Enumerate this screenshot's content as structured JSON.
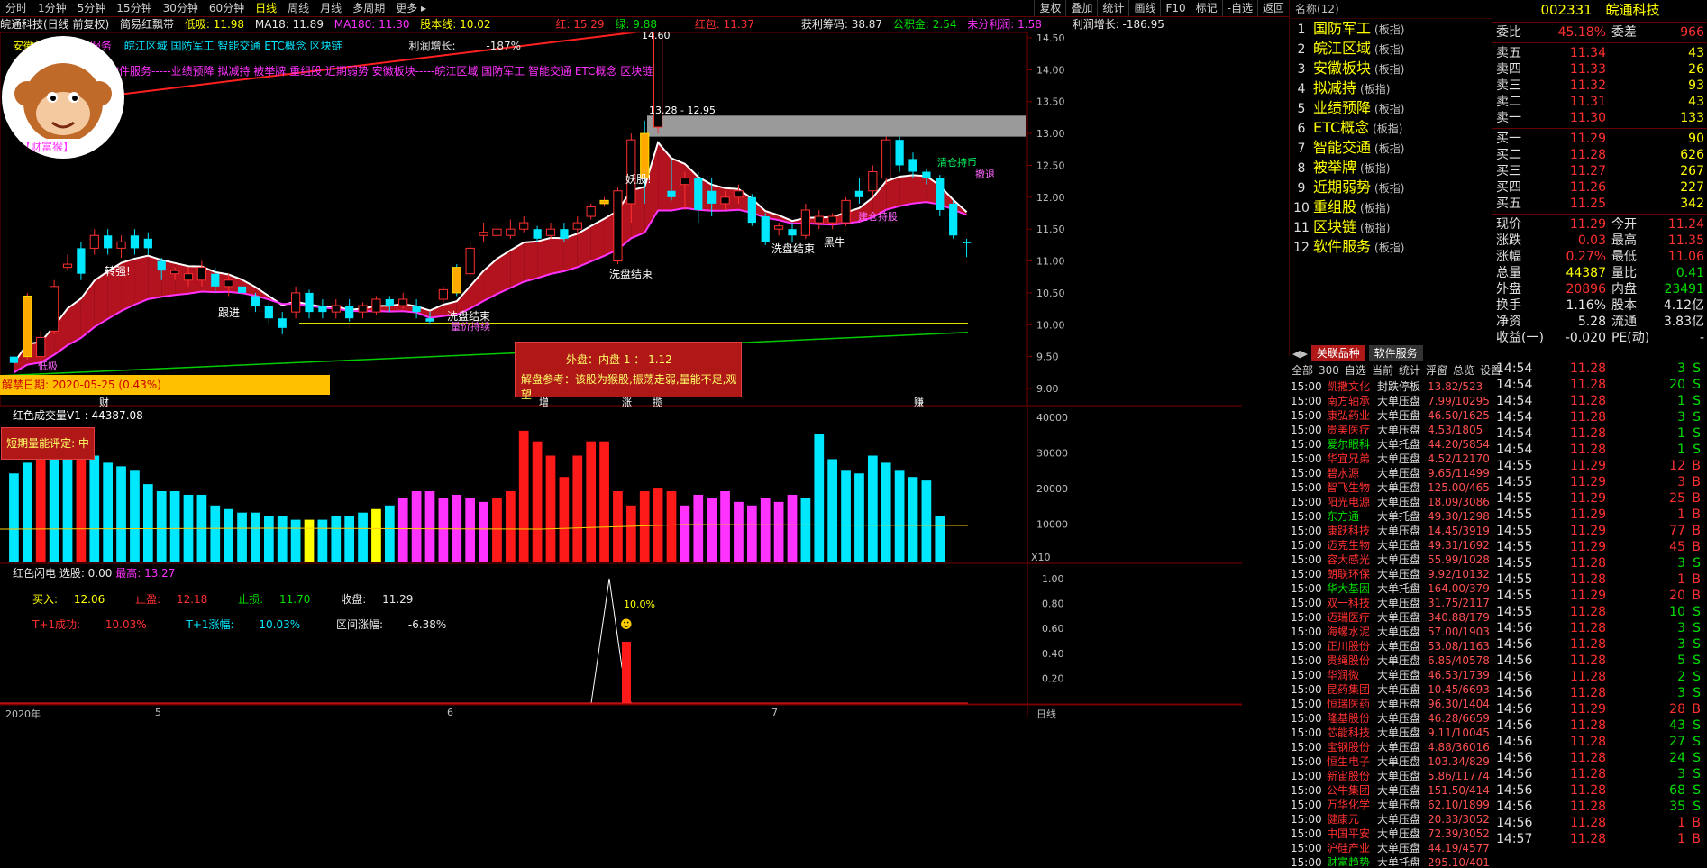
{
  "menu": {
    "items": [
      "分时",
      "1分钟",
      "5分钟",
      "15分钟",
      "30分钟",
      "60分钟",
      "日线",
      "周线",
      "月线",
      "多周期",
      "更多 ▸"
    ],
    "active_index": 6,
    "right_items": [
      "复权",
      "叠加",
      "统计",
      "画线",
      "F10",
      "标记",
      "-自选",
      "返回"
    ]
  },
  "info": {
    "stock": "皖通科技(日线 前复权)",
    "formula": "简易红飘带",
    "low_label": "低吸: 11.98",
    "ma18": "MA18: 11.89",
    "ma180": "MA180: 11.30",
    "stock_line": "股本线: 10.02",
    "red": "红: 15.29",
    "green": "绿: 9.88",
    "red_bag": "红包: 11.37",
    "profit_chip": "获利筹码: 38.87",
    "reserve": "公积金: 2.54",
    "undistributed": "未分利润: 1.58",
    "profit_growth": "利润增长: -186.95"
  },
  "overlay": {
    "tags_line1": [
      "安徽板块",
      "软件服务",
      "皖江区域",
      "国防军工",
      "智能交通",
      "ETC概念",
      "区块链"
    ],
    "profit_growth_label": "利润增长:",
    "profit_growth_value": "-187%",
    "logo_caption": "【财富猴】",
    "tags_line2": "软件服务-----业绩预降 拟减持 被举牌 重组股 近期弱势 安徽板块-----皖江区域 国防军工 智能交通 ETC概念 区块链",
    "unlock_date": "解禁日期: 2020-05-25 (0.43%)",
    "peak_label": "14.60",
    "range_label": "13.28 - 12.95",
    "annotations": [
      "转强!",
      "跟进",
      "洗盘结束",
      "洗盘结束",
      "量价持续",
      "妖股!",
      "洗盘结束",
      "洗盘结束",
      "黑牛",
      "建仓持股",
      "清仓持币",
      "撤退",
      "低吸"
    ],
    "bottom_marks": [
      "财",
      "增",
      "涨",
      "揽",
      "赚"
    ],
    "infobox_line1": "外盘：内盘   1  ：  1.12",
    "infobox_line2": "解盘参考：该股为猴股,振荡走弱,量能不足,观望"
  },
  "vol_panel": {
    "title": "红色成交量V1 : 44387.08",
    "box": "短期量能评定: 中",
    "y_ticks": [
      "40000",
      "30000",
      "20000",
      "10000"
    ],
    "scale": "X10"
  },
  "flash_panel": {
    "title": "红色闪电  选股: 0.00",
    "high": "最高: 13.27",
    "buy_label": "买入:",
    "buy": "12.06",
    "tp_label": "止盈:",
    "tp": "12.18",
    "sl_label": "止损:",
    "sl": "11.70",
    "close_label": "收盘:",
    "close": "11.29",
    "t1_success_label": "T+1成功:",
    "t1_success": "10.03%",
    "t1_gain_label": "T+1涨幅:",
    "t1_gain": "10.03%",
    "range_gain_label": "区间涨幅:",
    "range_gain": "-6.38%",
    "pct": "10.0%",
    "y_ticks": [
      "1.00",
      "0.80",
      "0.60",
      "0.40",
      "0.20"
    ]
  },
  "price_axis": [
    "14.50",
    "14.00",
    "13.50",
    "13.00",
    "12.50",
    "12.00",
    "11.50",
    "11.00",
    "10.50",
    "10.00",
    "9.50",
    "9.00"
  ],
  "date_axis": {
    "labels": [
      "2020年",
      "5",
      "6",
      "7"
    ],
    "period": "日线"
  },
  "sectors": {
    "header": "名称(12)",
    "items": [
      {
        "n": "1",
        "name": "国防军工",
        "type": "(板指)"
      },
      {
        "n": "2",
        "name": "皖江区域",
        "type": "(板指)"
      },
      {
        "n": "3",
        "name": "安徽板块",
        "type": "(板指)"
      },
      {
        "n": "4",
        "name": "拟减持",
        "type": "(板指)"
      },
      {
        "n": "5",
        "name": "业绩预降",
        "type": "(板指)"
      },
      {
        "n": "6",
        "name": "ETC概念",
        "type": "(板指)"
      },
      {
        "n": "7",
        "name": "智能交通",
        "type": "(板指)"
      },
      {
        "n": "8",
        "name": "被举牌",
        "type": "(板指)"
      },
      {
        "n": "9",
        "name": "近期弱势",
        "type": "(板指)"
      },
      {
        "n": "10",
        "name": "重组股",
        "type": "(板指)"
      },
      {
        "n": "11",
        "name": "区块链",
        "type": "(板指)"
      },
      {
        "n": "12",
        "name": "软件服务",
        "type": "(板指)"
      }
    ]
  },
  "quote": {
    "code": "002331",
    "name": "皖通科技",
    "ratio_label": "委比",
    "ratio": "45.18%",
    "diff_label": "委差",
    "diff": "966",
    "asks": [
      {
        "l": "卖五",
        "p": "11.34",
        "v": "43"
      },
      {
        "l": "卖四",
        "p": "11.33",
        "v": "26"
      },
      {
        "l": "卖三",
        "p": "11.32",
        "v": "93"
      },
      {
        "l": "卖二",
        "p": "11.31",
        "v": "43"
      },
      {
        "l": "卖一",
        "p": "11.30",
        "v": "133"
      }
    ],
    "bids": [
      {
        "l": "买一",
        "p": "11.29",
        "v": "90"
      },
      {
        "l": "买二",
        "p": "11.28",
        "v": "626"
      },
      {
        "l": "买三",
        "p": "11.27",
        "v": "267"
      },
      {
        "l": "买四",
        "p": "11.26",
        "v": "227"
      },
      {
        "l": "买五",
        "p": "11.25",
        "v": "342"
      }
    ],
    "stats": [
      {
        "a": "现价",
        "av": "11.29",
        "b": "今开",
        "bv": "11.24"
      },
      {
        "a": "涨跌",
        "av": "0.03",
        "b": "最高",
        "bv": "11.35"
      },
      {
        "a": "涨幅",
        "av": "0.27%",
        "b": "最低",
        "bv": "11.06"
      },
      {
        "a": "总量",
        "av": "44387",
        "b": "量比",
        "bv": "0.41"
      },
      {
        "a": "外盘",
        "av": "20896",
        "b": "内盘",
        "bv": "23491"
      },
      {
        "a": "换手",
        "av": "1.16%",
        "b": "股本",
        "bv": "4.12亿"
      },
      {
        "a": "净资",
        "av": "5.28",
        "b": "流通",
        "bv": "3.83亿"
      },
      {
        "a": "收益(一)",
        "av": "-0.020",
        "b": "PE(动)",
        "bv": "-"
      }
    ]
  },
  "rel_tabs": {
    "tab1": "关联品种",
    "tab2": "软件服务",
    "filters": [
      "全部",
      "300",
      "自选",
      "当前",
      "统计",
      "浮窗",
      "总览",
      "设置"
    ]
  },
  "rel_list": [
    {
      "t": "15:00",
      "s": "凯撒文化",
      "k": "封跌停板",
      "v": "13.82/523"
    },
    {
      "t": "15:00",
      "s": "南方轴承",
      "k": "大单压盘",
      "v": "7.99/10295"
    },
    {
      "t": "15:00",
      "s": "康弘药业",
      "k": "大单压盘",
      "v": "46.50/1625"
    },
    {
      "t": "15:00",
      "s": "贵美医疗",
      "k": "大单压盘",
      "v": "4.53/1805"
    },
    {
      "t": "15:00",
      "s": "爱尔眼科",
      "k": "大单托盘",
      "v": "44.20/5854"
    },
    {
      "t": "15:00",
      "s": "华宜兄弟",
      "k": "大单压盘",
      "v": "4.52/12170"
    },
    {
      "t": "15:00",
      "s": "碧水源",
      "k": "大单压盘",
      "v": "9.65/11499"
    },
    {
      "t": "15:00",
      "s": "智飞生物",
      "k": "大单压盘",
      "v": "125.00/465"
    },
    {
      "t": "15:00",
      "s": "阳光电源",
      "k": "大单压盘",
      "v": "18.09/3086"
    },
    {
      "t": "15:00",
      "s": "东方通",
      "k": "大单托盘",
      "v": "49.30/1298"
    },
    {
      "t": "15:00",
      "s": "康跃科技",
      "k": "大单压盘",
      "v": "14.45/3919"
    },
    {
      "t": "15:00",
      "s": "迈克生物",
      "k": "大单压盘",
      "v": "49.31/1692"
    },
    {
      "t": "15:00",
      "s": "容大感光",
      "k": "大单压盘",
      "v": "55.99/1028"
    },
    {
      "t": "15:00",
      "s": "朗联环保",
      "k": "大单压盘",
      "v": "9.92/10132"
    },
    {
      "t": "15:00",
      "s": "华大基因",
      "k": "大单托盘",
      "v": "164.00/379"
    },
    {
      "t": "15:00",
      "s": "双一科技",
      "k": "大单压盘",
      "v": "31.75/2117"
    },
    {
      "t": "15:00",
      "s": "迈瑞医疗",
      "k": "大单压盘",
      "v": "340.88/179"
    },
    {
      "t": "15:00",
      "s": "海螺水泥",
      "k": "大单压盘",
      "v": "57.00/1903"
    },
    {
      "t": "15:00",
      "s": "正川股份",
      "k": "大单压盘",
      "v": "53.08/1163"
    },
    {
      "t": "15:00",
      "s": "贵绳股份",
      "k": "大单压盘",
      "v": "6.85/40578"
    },
    {
      "t": "15:00",
      "s": "华润微",
      "k": "大单压盘",
      "v": "46.53/1739"
    },
    {
      "t": "15:00",
      "s": "昆药集团",
      "k": "大单压盘",
      "v": "10.45/6693"
    },
    {
      "t": "15:00",
      "s": "恒瑞医药",
      "k": "大单压盘",
      "v": "96.30/1404"
    },
    {
      "t": "15:00",
      "s": "隆基股份",
      "k": "大单压盘",
      "v": "46.28/6659"
    },
    {
      "t": "15:00",
      "s": "芯能科技",
      "k": "大单压盘",
      "v": "9.11/10045"
    },
    {
      "t": "15:00",
      "s": "宝钢股份",
      "k": "大单压盘",
      "v": "4.88/36016"
    },
    {
      "t": "15:00",
      "s": "恒生电子",
      "k": "大单压盘",
      "v": "103.34/829"
    },
    {
      "t": "15:00",
      "s": "新宙股份",
      "k": "大单压盘",
      "v": "5.86/11774"
    },
    {
      "t": "15:00",
      "s": "公牛集团",
      "k": "大单压盘",
      "v": "151.50/414"
    },
    {
      "t": "15:00",
      "s": "万华化学",
      "k": "大单压盘",
      "v": "62.10/1899"
    },
    {
      "t": "15:00",
      "s": "健康元",
      "k": "大单压盘",
      "v": "20.33/3052"
    },
    {
      "t": "15:00",
      "s": "中国平安",
      "k": "大单压盘",
      "v": "72.39/3052"
    },
    {
      "t": "15:00",
      "s": "沪硅产业",
      "k": "大单压盘",
      "v": "44.19/4577"
    },
    {
      "t": "15:00",
      "s": "财富趋势",
      "k": "大单托盘",
      "v": "295.10/401"
    }
  ],
  "ticks": [
    {
      "t": "14:54",
      "p": "11.28",
      "v": "3",
      "d": "S"
    },
    {
      "t": "14:54",
      "p": "11.28",
      "v": "20",
      "d": "S"
    },
    {
      "t": "14:54",
      "p": "11.28",
      "v": "1",
      "d": "S"
    },
    {
      "t": "14:54",
      "p": "11.28",
      "v": "3",
      "d": "S"
    },
    {
      "t": "14:54",
      "p": "11.28",
      "v": "1",
      "d": "S"
    },
    {
      "t": "14:54",
      "p": "11.28",
      "v": "1",
      "d": "S"
    },
    {
      "t": "14:55",
      "p": "11.29",
      "v": "12",
      "d": "B"
    },
    {
      "t": "14:55",
      "p": "11.29",
      "v": "3",
      "d": "B"
    },
    {
      "t": "14:55",
      "p": "11.29",
      "v": "25",
      "d": "B"
    },
    {
      "t": "14:55",
      "p": "11.29",
      "v": "1",
      "d": "B"
    },
    {
      "t": "14:55",
      "p": "11.29",
      "v": "77",
      "d": "B"
    },
    {
      "t": "14:55",
      "p": "11.29",
      "v": "45",
      "d": "B"
    },
    {
      "t": "14:55",
      "p": "11.28",
      "v": "3",
      "d": "S"
    },
    {
      "t": "14:55",
      "p": "11.28",
      "v": "1",
      "d": "B"
    },
    {
      "t": "14:55",
      "p": "11.29",
      "v": "20",
      "d": "B"
    },
    {
      "t": "14:55",
      "p": "11.28",
      "v": "10",
      "d": "S"
    },
    {
      "t": "14:56",
      "p": "11.28",
      "v": "3",
      "d": "S"
    },
    {
      "t": "14:56",
      "p": "11.28",
      "v": "3",
      "d": "S"
    },
    {
      "t": "14:56",
      "p": "11.28",
      "v": "5",
      "d": "S"
    },
    {
      "t": "14:56",
      "p": "11.28",
      "v": "2",
      "d": "S"
    },
    {
      "t": "14:56",
      "p": "11.28",
      "v": "3",
      "d": "S"
    },
    {
      "t": "14:56",
      "p": "11.29",
      "v": "28",
      "d": "B"
    },
    {
      "t": "14:56",
      "p": "11.28",
      "v": "43",
      "d": "S"
    },
    {
      "t": "14:56",
      "p": "11.28",
      "v": "27",
      "d": "S"
    },
    {
      "t": "14:56",
      "p": "11.28",
      "v": "24",
      "d": "S"
    },
    {
      "t": "14:56",
      "p": "11.28",
      "v": "3",
      "d": "S"
    },
    {
      "t": "14:56",
      "p": "11.28",
      "v": "68",
      "d": "S"
    },
    {
      "t": "14:56",
      "p": "11.28",
      "v": "35",
      "d": "S"
    },
    {
      "t": "14:56",
      "p": "11.28",
      "v": "1",
      "d": "B"
    },
    {
      "t": "14:57",
      "p": "11.28",
      "v": "1",
      "d": "B"
    }
  ],
  "chart_data": {
    "type": "candlestick",
    "period": "daily",
    "price_range": [
      9.0,
      14.6
    ],
    "candles": [
      {
        "o": 9.5,
        "c": 9.4,
        "h": 9.55,
        "l": 9.3
      },
      {
        "o": 9.5,
        "c": 10.45,
        "h": 10.5,
        "l": 9.45
      },
      {
        "o": 9.5,
        "c": 9.8,
        "h": 9.9,
        "l": 9.45
      },
      {
        "o": 9.9,
        "c": 10.6,
        "h": 10.7,
        "l": 9.85
      },
      {
        "o": 10.9,
        "c": 10.95,
        "h": 11.1,
        "l": 10.85
      },
      {
        "o": 11.2,
        "c": 10.8,
        "h": 11.3,
        "l": 10.7
      },
      {
        "o": 11.2,
        "c": 11.4,
        "h": 11.5,
        "l": 11.1
      },
      {
        "o": 11.4,
        "c": 11.2,
        "h": 11.5,
        "l": 11.1
      },
      {
        "o": 11.2,
        "c": 11.3,
        "h": 11.4,
        "l": 11.05
      },
      {
        "o": 11.4,
        "c": 11.2,
        "h": 11.5,
        "l": 11.1
      },
      {
        "o": 11.35,
        "c": 11.2,
        "h": 11.45,
        "l": 11.1
      },
      {
        "o": 11.0,
        "c": 10.85,
        "h": 11.05,
        "l": 10.7
      },
      {
        "o": 10.8,
        "c": 10.85,
        "h": 10.9,
        "l": 10.7
      },
      {
        "o": 10.7,
        "c": 10.8,
        "h": 10.9,
        "l": 10.6
      },
      {
        "o": 10.7,
        "c": 10.9,
        "h": 11.0,
        "l": 10.6
      },
      {
        "o": 10.8,
        "c": 10.6,
        "h": 10.9,
        "l": 10.5
      },
      {
        "o": 10.6,
        "c": 10.7,
        "h": 10.8,
        "l": 10.45
      },
      {
        "o": 10.6,
        "c": 10.5,
        "h": 10.7,
        "l": 10.4
      },
      {
        "o": 10.45,
        "c": 10.3,
        "h": 10.5,
        "l": 10.2
      },
      {
        "o": 10.3,
        "c": 10.1,
        "h": 10.35,
        "l": 10.0
      },
      {
        "o": 10.1,
        "c": 9.95,
        "h": 10.2,
        "l": 9.85
      },
      {
        "o": 10.2,
        "c": 10.5,
        "h": 10.6,
        "l": 10.1
      },
      {
        "o": 10.5,
        "c": 10.2,
        "h": 10.55,
        "l": 10.1
      },
      {
        "o": 10.3,
        "c": 10.2,
        "h": 10.4,
        "l": 10.1
      },
      {
        "o": 10.2,
        "c": 10.3,
        "h": 10.4,
        "l": 10.1
      },
      {
        "o": 10.3,
        "c": 10.1,
        "h": 10.4,
        "l": 10.05
      },
      {
        "o": 10.2,
        "c": 10.3,
        "h": 10.35,
        "l": 10.1
      },
      {
        "o": 10.2,
        "c": 10.4,
        "h": 10.45,
        "l": 10.15
      },
      {
        "o": 10.4,
        "c": 10.3,
        "h": 10.45,
        "l": 10.2
      },
      {
        "o": 10.3,
        "c": 10.4,
        "h": 10.5,
        "l": 10.25
      },
      {
        "o": 10.3,
        "c": 10.2,
        "h": 10.4,
        "l": 10.1
      },
      {
        "o": 10.1,
        "c": 10.05,
        "h": 10.2,
        "l": 10.0
      },
      {
        "o": 10.4,
        "c": 10.55,
        "h": 10.6,
        "l": 10.35
      },
      {
        "o": 10.9,
        "c": 10.5,
        "h": 10.95,
        "l": 10.45
      },
      {
        "o": 10.8,
        "c": 11.2,
        "h": 11.3,
        "l": 10.75
      },
      {
        "o": 11.4,
        "c": 11.45,
        "h": 11.6,
        "l": 11.3
      },
      {
        "o": 11.4,
        "c": 11.5,
        "h": 11.6,
        "l": 11.3
      },
      {
        "o": 11.4,
        "c": 11.5,
        "h": 11.65,
        "l": 11.35
      },
      {
        "o": 11.5,
        "c": 11.6,
        "h": 11.7,
        "l": 11.45
      },
      {
        "o": 11.5,
        "c": 11.35,
        "h": 11.55,
        "l": 11.3
      },
      {
        "o": 11.4,
        "c": 11.5,
        "h": 11.6,
        "l": 11.35
      },
      {
        "o": 11.5,
        "c": 11.35,
        "h": 11.6,
        "l": 11.3
      },
      {
        "o": 11.5,
        "c": 11.6,
        "h": 11.7,
        "l": 11.4
      },
      {
        "o": 11.7,
        "c": 11.85,
        "h": 11.9,
        "l": 11.65
      },
      {
        "o": 11.9,
        "c": 11.95,
        "h": 12.0,
        "l": 11.85
      },
      {
        "o": 11.0,
        "c": 12.1,
        "h": 12.15,
        "l": 10.95
      },
      {
        "o": 11.9,
        "c": 12.9,
        "h": 13.0,
        "l": 11.6
      },
      {
        "o": 13.0,
        "c": 12.3,
        "h": 13.2,
        "l": 11.9
      },
      {
        "o": 13.1,
        "c": 14.6,
        "h": 14.6,
        "l": 13.0
      },
      {
        "o": 12.1,
        "c": 12.0,
        "h": 12.6,
        "l": 11.95
      },
      {
        "o": 12.2,
        "c": 12.3,
        "h": 12.4,
        "l": 11.8
      },
      {
        "o": 12.3,
        "c": 11.8,
        "h": 12.4,
        "l": 11.6
      },
      {
        "o": 12.1,
        "c": 11.9,
        "h": 12.3,
        "l": 11.7
      },
      {
        "o": 11.9,
        "c": 12.0,
        "h": 12.1,
        "l": 11.8
      },
      {
        "o": 12.0,
        "c": 12.1,
        "h": 12.2,
        "l": 11.9
      },
      {
        "o": 12.0,
        "c": 11.6,
        "h": 12.05,
        "l": 11.55
      },
      {
        "o": 11.7,
        "c": 11.3,
        "h": 11.75,
        "l": 11.25
      },
      {
        "o": 11.5,
        "c": 11.55,
        "h": 11.6,
        "l": 11.4
      },
      {
        "o": 11.5,
        "c": 11.4,
        "h": 11.6,
        "l": 11.3
      },
      {
        "o": 11.4,
        "c": 11.8,
        "h": 11.9,
        "l": 11.35
      },
      {
        "o": 11.6,
        "c": 11.7,
        "h": 11.8,
        "l": 11.5
      },
      {
        "o": 11.6,
        "c": 11.7,
        "h": 11.75,
        "l": 11.5
      },
      {
        "o": 11.6,
        "c": 11.95,
        "h": 12.0,
        "l": 11.55
      },
      {
        "o": 12.1,
        "c": 12.0,
        "h": 12.3,
        "l": 11.9
      },
      {
        "o": 12.1,
        "c": 12.4,
        "h": 12.5,
        "l": 12.0
      },
      {
        "o": 12.3,
        "c": 12.9,
        "h": 12.95,
        "l": 12.2
      },
      {
        "o": 12.9,
        "c": 12.5,
        "h": 12.95,
        "l": 12.4
      },
      {
        "o": 12.6,
        "c": 12.4,
        "h": 12.7,
        "l": 12.3
      },
      {
        "o": 12.4,
        "c": 12.3,
        "h": 12.45,
        "l": 12.2
      },
      {
        "o": 12.3,
        "c": 11.8,
        "h": 12.35,
        "l": 11.7
      },
      {
        "o": 11.9,
        "c": 11.4,
        "h": 11.95,
        "l": 11.35
      },
      {
        "o": 11.3,
        "c": 11.29,
        "h": 11.35,
        "l": 11.06
      }
    ],
    "volumes": [
      2.5,
      2.8,
      3.0,
      3.3,
      3.3,
      3.2,
      3.0,
      2.8,
      2.7,
      2.6,
      2.2,
      2.0,
      2.0,
      1.9,
      1.9,
      1.6,
      1.5,
      1.4,
      1.4,
      1.3,
      1.3,
      1.2,
      1.2,
      1.2,
      1.3,
      1.3,
      1.4,
      1.5,
      1.6,
      1.8,
      2.0,
      2.0,
      1.8,
      1.9,
      1.8,
      1.7,
      1.8,
      2.0,
      3.7,
      3.4,
      3.0,
      2.4,
      3.0,
      3.4,
      3.4,
      2.0,
      1.6,
      2.0,
      2.1,
      2.0,
      1.6,
      1.9,
      1.8,
      2.0,
      1.7,
      1.6,
      1.8,
      1.7,
      1.9,
      1.8,
      3.6,
      2.9,
      2.6,
      2.5,
      3.0,
      2.8,
      2.6,
      2.4,
      2.3,
      1.3
    ],
    "ma18": [],
    "ma180": []
  }
}
